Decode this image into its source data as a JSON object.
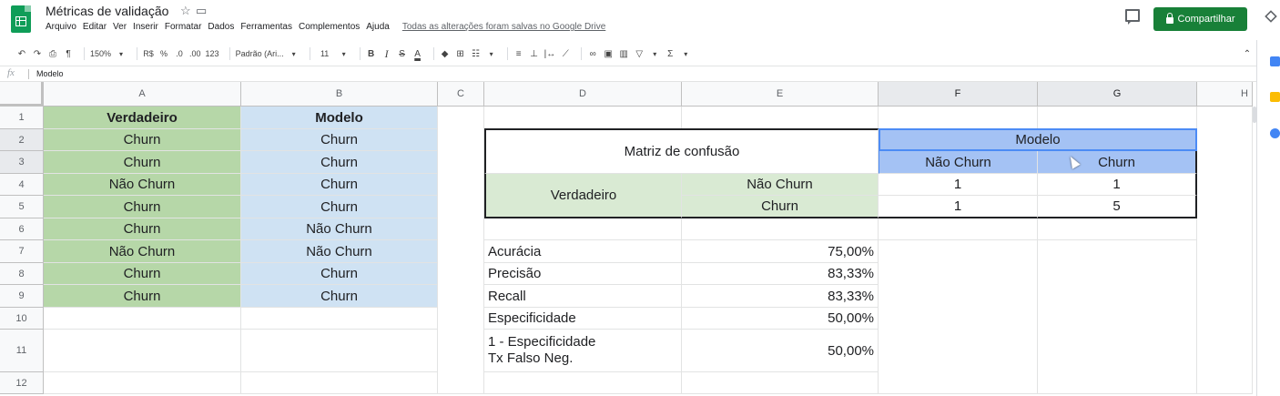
{
  "header": {
    "doc_title": "Métricas de validação",
    "star_icon": "star-icon",
    "folder_icon": "folder-icon",
    "menu": [
      "Arquivo",
      "Editar",
      "Ver",
      "Inserir",
      "Formatar",
      "Dados",
      "Ferramentas",
      "Complementos",
      "Ajuda"
    ],
    "saved_status": "Todas as alterações foram salvas no Google Drive",
    "share_label": "Compartilhar",
    "colors": {
      "share": "#188038",
      "logo": "#0f9d58"
    }
  },
  "toolbar": {
    "undo": "↶",
    "redo": "↷",
    "print": "⎙",
    "paint_format": "¶",
    "zoom": "150%",
    "currency": "R$",
    "percent": "%",
    "decrease_decimal": ".0",
    "increase_decimal": ".00",
    "more_formats": "123",
    "font": "Padrão (Ari...",
    "font_size": "11",
    "bold": "B",
    "italic": "I",
    "strike": "S",
    "text_color": "A",
    "fill": "◆",
    "borders": "⊞",
    "merge": "☷",
    "align": "≡",
    "valign": "⊥",
    "wrap": "|↔",
    "rotate": "⟋",
    "link": "∞",
    "comment": "▣",
    "chart": "▥",
    "filter": "▽",
    "functions": "Σ",
    "collapse": "⌃"
  },
  "formula_bar": {
    "fx": "fx",
    "value": "Modelo"
  },
  "grid": {
    "columns": [
      "A",
      "B",
      "C",
      "D",
      "E",
      "F",
      "G",
      "H"
    ],
    "rows": [
      "1",
      "2",
      "3",
      "4",
      "5",
      "6",
      "7",
      "8",
      "9",
      "10",
      "11",
      "12"
    ],
    "colA": [
      "Verdadeiro",
      "Churn",
      "Churn",
      "Não Churn",
      "Churn",
      "Churn",
      "Não Churn",
      "Churn",
      "Churn"
    ],
    "colB": [
      "Modelo",
      "Churn",
      "Churn",
      "Churn",
      "Churn",
      "Não Churn",
      "Não Churn",
      "Churn",
      "Churn"
    ],
    "matrix": {
      "title": "Matriz de confusão",
      "model_header": "Modelo",
      "pred_no": "Não Churn",
      "pred_yes": "Churn",
      "true_label": "Verdadeiro",
      "true_no": "Não Churn",
      "true_yes": "Churn",
      "tn": "1",
      "fp": "1",
      "fn": "1",
      "tp": "5"
    },
    "metrics": [
      {
        "label": "Acurácia",
        "value": "75,00%"
      },
      {
        "label": "Precisão",
        "value": "83,33%"
      },
      {
        "label": "Recall",
        "value": "83,33%"
      },
      {
        "label": "Especificidade",
        "value": "50,00%"
      },
      {
        "label": "1 - Especificidade\nTx Falso Neg.",
        "value": "50,00%"
      }
    ]
  },
  "side_panel": {
    "icons": [
      "calendar-icon",
      "keep-icon",
      "tasks-icon"
    ]
  }
}
